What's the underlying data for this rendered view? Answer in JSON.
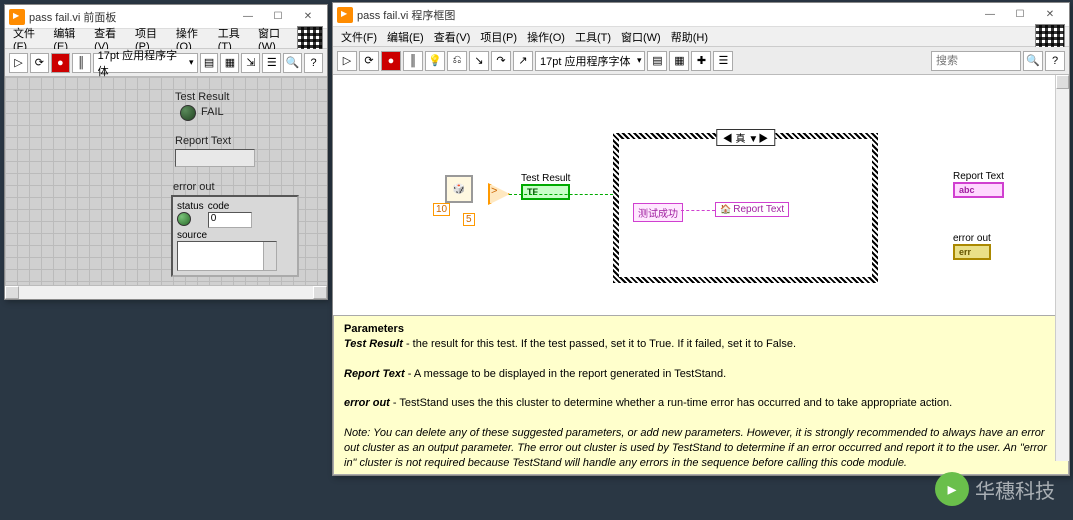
{
  "fp": {
    "title": "pass fail.vi 前面板",
    "menus": [
      "文件(F)",
      "编辑(E)",
      "查看(V)",
      "项目(P)",
      "操作(O)",
      "工具(T)",
      "窗口(W)"
    ],
    "font": "17pt 应用程序字体",
    "labels": {
      "testResult": "Test Result",
      "fail": "FAIL",
      "reportText": "Report Text",
      "errorOut": "error out",
      "status": "status",
      "code": "code",
      "codeVal": "0",
      "source": "source"
    }
  },
  "bd": {
    "title": "pass fail.vi 程序框图",
    "menus": [
      "文件(F)",
      "编辑(E)",
      "查看(V)",
      "项目(P)",
      "操作(O)",
      "工具(T)",
      "窗口(W)",
      "帮助(H)"
    ],
    "font": "17pt 应用程序字体",
    "searchPlaceholder": "搜索",
    "caseSelector": "◀ 真 ▼▶",
    "terminals": {
      "testResult": {
        "label": "Test Result",
        "box": "TF"
      },
      "reportText": {
        "label": "Report Text",
        "box": "abc"
      },
      "errorOut": {
        "label": "error out",
        "box": "err"
      }
    },
    "consts": {
      "ten": "10",
      "five": "5"
    },
    "strConst": "测试成功",
    "localVar": "Report Text",
    "cmpGlyph": ">"
  },
  "params": {
    "heading": "Parameters",
    "p1_label": "Test Result",
    "p1_text": " - the result for this test.  If the test passed, set it to True.  If it failed, set it to False.",
    "p2_label": "Report Text",
    "p2_text": " - A message to be displayed in the report generated in TestStand.",
    "p3_label": "error out",
    "p3_text": " - TestStand uses the this cluster to determine whether a run-time error has occurred and to take appropriate action.",
    "note": "Note: You can delete any of these suggested parameters, or add new parameters.  However, it is strongly recommended to always have an error out cluster as an output parameter.  The error out cluster is used by TestStand to determine if an error occurred and report it to the user.  An \"error in\" cluster is not required because TestStand will handle any errors in the sequence before calling this code module."
  },
  "watermark": "华穗科技"
}
